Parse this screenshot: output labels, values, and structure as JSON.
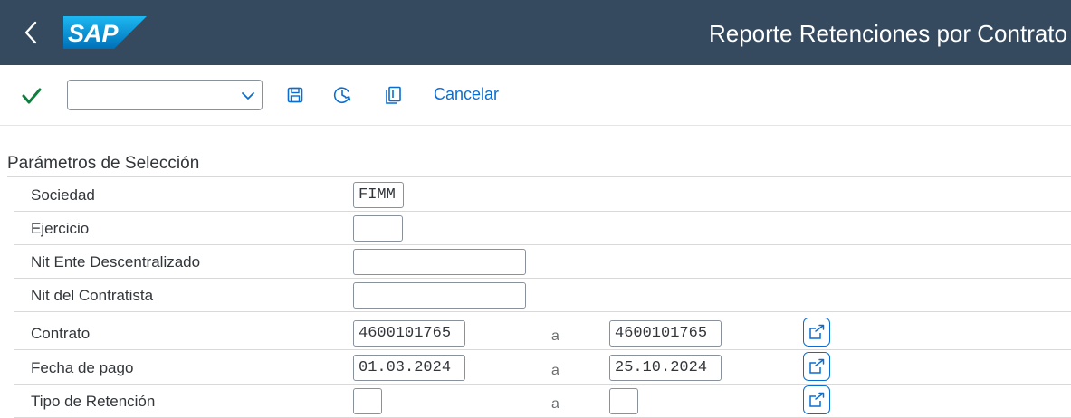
{
  "shell": {
    "brand": "SAP",
    "title": "Reporte Retenciones por Contrato"
  },
  "toolbar": {
    "command_field_value": "",
    "cancel_label": "Cancelar"
  },
  "section": {
    "title": "Parámetros de Selección"
  },
  "params": {
    "sociedad": {
      "label": "Sociedad",
      "value": "FIMM"
    },
    "ejercicio": {
      "label": "Ejercicio",
      "value": ""
    },
    "nit_ente": {
      "label": "Nit Ente Descentralizado",
      "value": ""
    },
    "nit_contratista": {
      "label": "Nit del Contratista",
      "value": ""
    },
    "contrato": {
      "label": "Contrato",
      "from": "4600101765",
      "to_label": "a",
      "to": "4600101765"
    },
    "fecha_pago": {
      "label": "Fecha de pago",
      "from": "01.03.2024",
      "to_label": "a",
      "to": "25.10.2024"
    },
    "tipo_retencion": {
      "label": "Tipo de Retención",
      "from": "",
      "to_label": "a",
      "to": ""
    }
  },
  "colors": {
    "shell_bg": "#354a5f",
    "accent": "#0a6ed1",
    "ok_green": "#107e3e",
    "sap_blue": "#0faaff"
  }
}
